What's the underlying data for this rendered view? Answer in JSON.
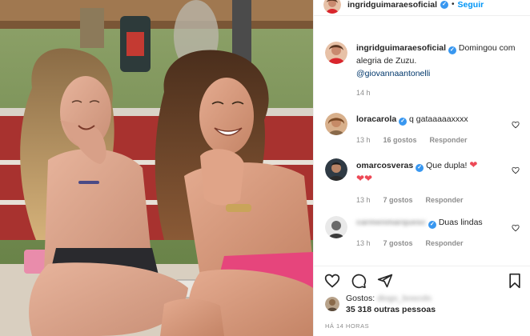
{
  "post": {
    "author": "ingridguimaraesoficial",
    "follow_label": "Seguir",
    "caption_text": "Domingou com alegria de Zuzu.",
    "caption_mention": "@giovannaantonelli",
    "caption_time": "14 h"
  },
  "comments": [
    {
      "user": "loracarola",
      "verified": true,
      "text": "q gataaaaaxxxx",
      "time": "13 h",
      "likes": "16 gostos",
      "reply": "Responder"
    },
    {
      "user": "omarcosveras",
      "verified": true,
      "text": "Que dupla!",
      "emoji_inline": "❤",
      "emoji_line": "❤❤",
      "time": "13 h",
      "likes": "7 gostos",
      "reply": "Responder"
    },
    {
      "user": "carmenmarquesc",
      "verified": true,
      "text": "Duas lindas",
      "time": "13 h",
      "likes": "7 gostos",
      "reply": "Responder"
    }
  ],
  "likes": {
    "label": "Gostos:",
    "liked_by": "diogo_boscolo",
    "others": "35 318 outras pessoas"
  },
  "posted_ago": "HÁ 14 HORAS",
  "colors": {
    "accent": "#0095f6",
    "verified": "#3897f0",
    "heart": "#ed4956"
  }
}
